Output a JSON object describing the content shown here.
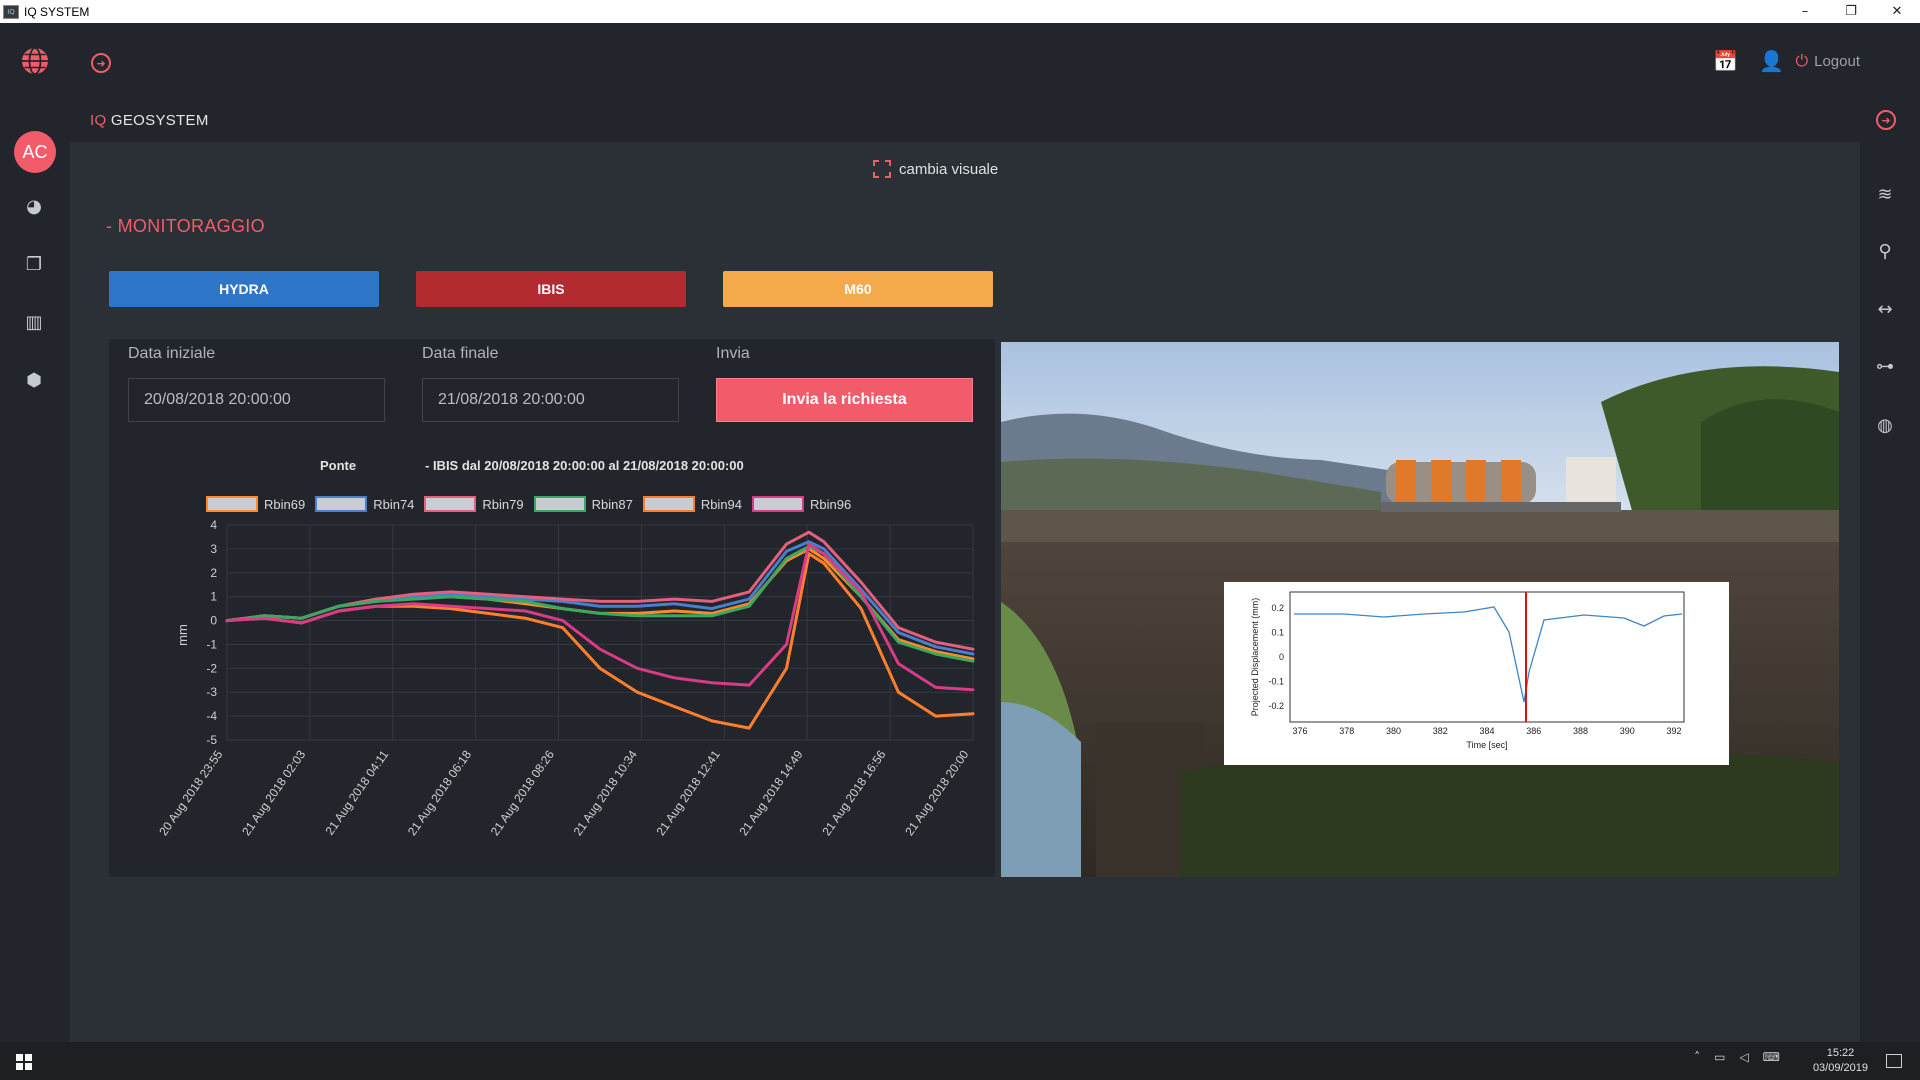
{
  "window": {
    "title": "IQ SYSTEM",
    "minimize": "–",
    "restore": "❐",
    "close": "✕"
  },
  "topbar": {
    "logout_label": "Logout"
  },
  "brand": {
    "prefix": "IQ",
    "name": " GEOSYSTEM"
  },
  "user": {
    "initials": "AC"
  },
  "view_toggle": {
    "label": "cambia visuale"
  },
  "section": {
    "title": "- MONITORAGGIO"
  },
  "systems": [
    {
      "label": "HYDRA",
      "color": "#2f76c9"
    },
    {
      "label": "IBIS",
      "color": "#b42a31"
    },
    {
      "label": "M60",
      "color": "#f4a94a"
    }
  ],
  "form": {
    "start_label": "Data iniziale",
    "start_value": "20/08/2018 20:00:00",
    "end_label": "Data finale",
    "end_value": "21/08/2018 20:00:00",
    "send_label": "Invia",
    "send_button": "Invia la richiesta"
  },
  "chart_data": {
    "type": "line",
    "title_left": "Ponte",
    "title": "- IBIS dal 20/08/2018 20:00:00 al 21/08/2018 20:00:00",
    "ylabel": "mm",
    "xlabel": "",
    "ylim": [
      -5,
      4
    ],
    "yticks": [
      "4",
      "3",
      "2",
      "1",
      "0",
      "-1",
      "-2",
      "-3",
      "-4",
      "-5"
    ],
    "grid": true,
    "legend_position": "top",
    "x_tick_labels": [
      "20 Aug 2018 23:55",
      "21 Aug 2018 02:03",
      "21 Aug 2018 04:11",
      "21 Aug 2018 06:18",
      "21 Aug 2018 08:26",
      "21 Aug 2018 10:34",
      "21 Aug 2018 12:41",
      "21 Aug 2018 14:49",
      "21 Aug 2018 16:56",
      "21 Aug 2018 20:00"
    ],
    "x": [
      0,
      0.05,
      0.1,
      0.15,
      0.2,
      0.25,
      0.3,
      0.35,
      0.4,
      0.45,
      0.5,
      0.55,
      0.6,
      0.65,
      0.7,
      0.75,
      0.78,
      0.8,
      0.85,
      0.9,
      0.95,
      1.0
    ],
    "series": [
      {
        "name": "Rbin69",
        "color": "#ff8a2a",
        "values": [
          0.0,
          0.2,
          0.1,
          0.6,
          0.8,
          1.0,
          1.0,
          0.9,
          0.7,
          0.5,
          0.3,
          0.3,
          0.4,
          0.3,
          0.7,
          2.5,
          3.0,
          2.6,
          1.0,
          -0.8,
          -1.3,
          -1.6
        ]
      },
      {
        "name": "Rbin74",
        "color": "#4a7fd0",
        "values": [
          0.0,
          0.2,
          0.1,
          0.6,
          0.9,
          1.0,
          1.1,
          1.0,
          0.9,
          0.8,
          0.6,
          0.6,
          0.7,
          0.5,
          0.9,
          2.9,
          3.3,
          3.0,
          1.3,
          -0.5,
          -1.1,
          -1.4
        ]
      },
      {
        "name": "Rbin79",
        "color": "#e4607c",
        "values": [
          0.0,
          0.2,
          0.1,
          0.6,
          0.9,
          1.1,
          1.2,
          1.1,
          1.0,
          0.9,
          0.8,
          0.8,
          0.9,
          0.8,
          1.2,
          3.2,
          3.7,
          3.3,
          1.6,
          -0.3,
          -0.9,
          -1.2
        ]
      },
      {
        "name": "Rbin87",
        "color": "#3aa860",
        "values": [
          0.0,
          0.2,
          0.1,
          0.6,
          0.8,
          0.9,
          1.0,
          0.9,
          0.8,
          0.5,
          0.3,
          0.2,
          0.2,
          0.2,
          0.6,
          2.6,
          3.1,
          2.8,
          1.0,
          -0.9,
          -1.4,
          -1.7
        ]
      },
      {
        "name": "Rbin94",
        "color": "#ff7f2e",
        "values": [
          0.0,
          0.1,
          -0.1,
          0.4,
          0.6,
          0.6,
          0.5,
          0.3,
          0.1,
          -0.3,
          -2.0,
          -3.0,
          -3.6,
          -4.2,
          -4.5,
          -2.0,
          2.8,
          2.4,
          0.5,
          -3.0,
          -4.0,
          -3.9
        ]
      },
      {
        "name": "Rbin96",
        "color": "#d93b86",
        "values": [
          0.0,
          0.1,
          -0.1,
          0.4,
          0.6,
          0.7,
          0.6,
          0.5,
          0.4,
          0.0,
          -1.2,
          -2.0,
          -2.4,
          -2.6,
          -2.7,
          -1.0,
          3.2,
          2.8,
          1.2,
          -1.8,
          -2.8,
          -2.9
        ]
      }
    ]
  },
  "inset_chart": {
    "ylabel": "Projected Displacement (mm)",
    "xlabel": "Time [sec]",
    "xticks": [
      "376",
      "378",
      "380",
      "382",
      "384",
      "386",
      "388",
      "390",
      "392"
    ],
    "yticks": [
      "0.2",
      "0.1",
      "0",
      "-0.1",
      "-0.2"
    ]
  },
  "taskbar": {
    "time": "15:22",
    "date": "03/09/2019"
  }
}
